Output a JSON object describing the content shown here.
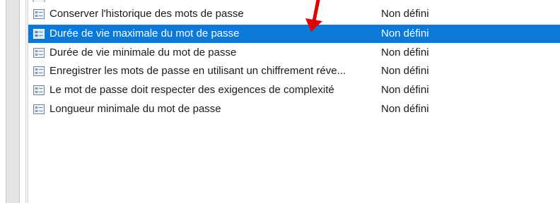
{
  "policies": [
    {
      "name": "Conserver l'historique des mots de passe",
      "setting": "Non défini"
    },
    {
      "name": "Durée de vie maximale du mot de passe",
      "setting": "Non défini",
      "selected": true
    },
    {
      "name": "Durée de vie minimale du mot de passe",
      "setting": "Non défini"
    },
    {
      "name": "Enregistrer les mots de passe en utilisant un chiffrement réve...",
      "setting": "Non défini"
    },
    {
      "name": "Le mot de passe doit respecter des exigences de complexité",
      "setting": "Non défini"
    },
    {
      "name": "Longueur minimale du mot de passe",
      "setting": "Non défini"
    }
  ],
  "colors": {
    "selection": "#0a79d8",
    "arrow": "#e00000"
  },
  "icons": {
    "policy": "policy-document-icon",
    "annotation": "red-arrow-annotation"
  }
}
